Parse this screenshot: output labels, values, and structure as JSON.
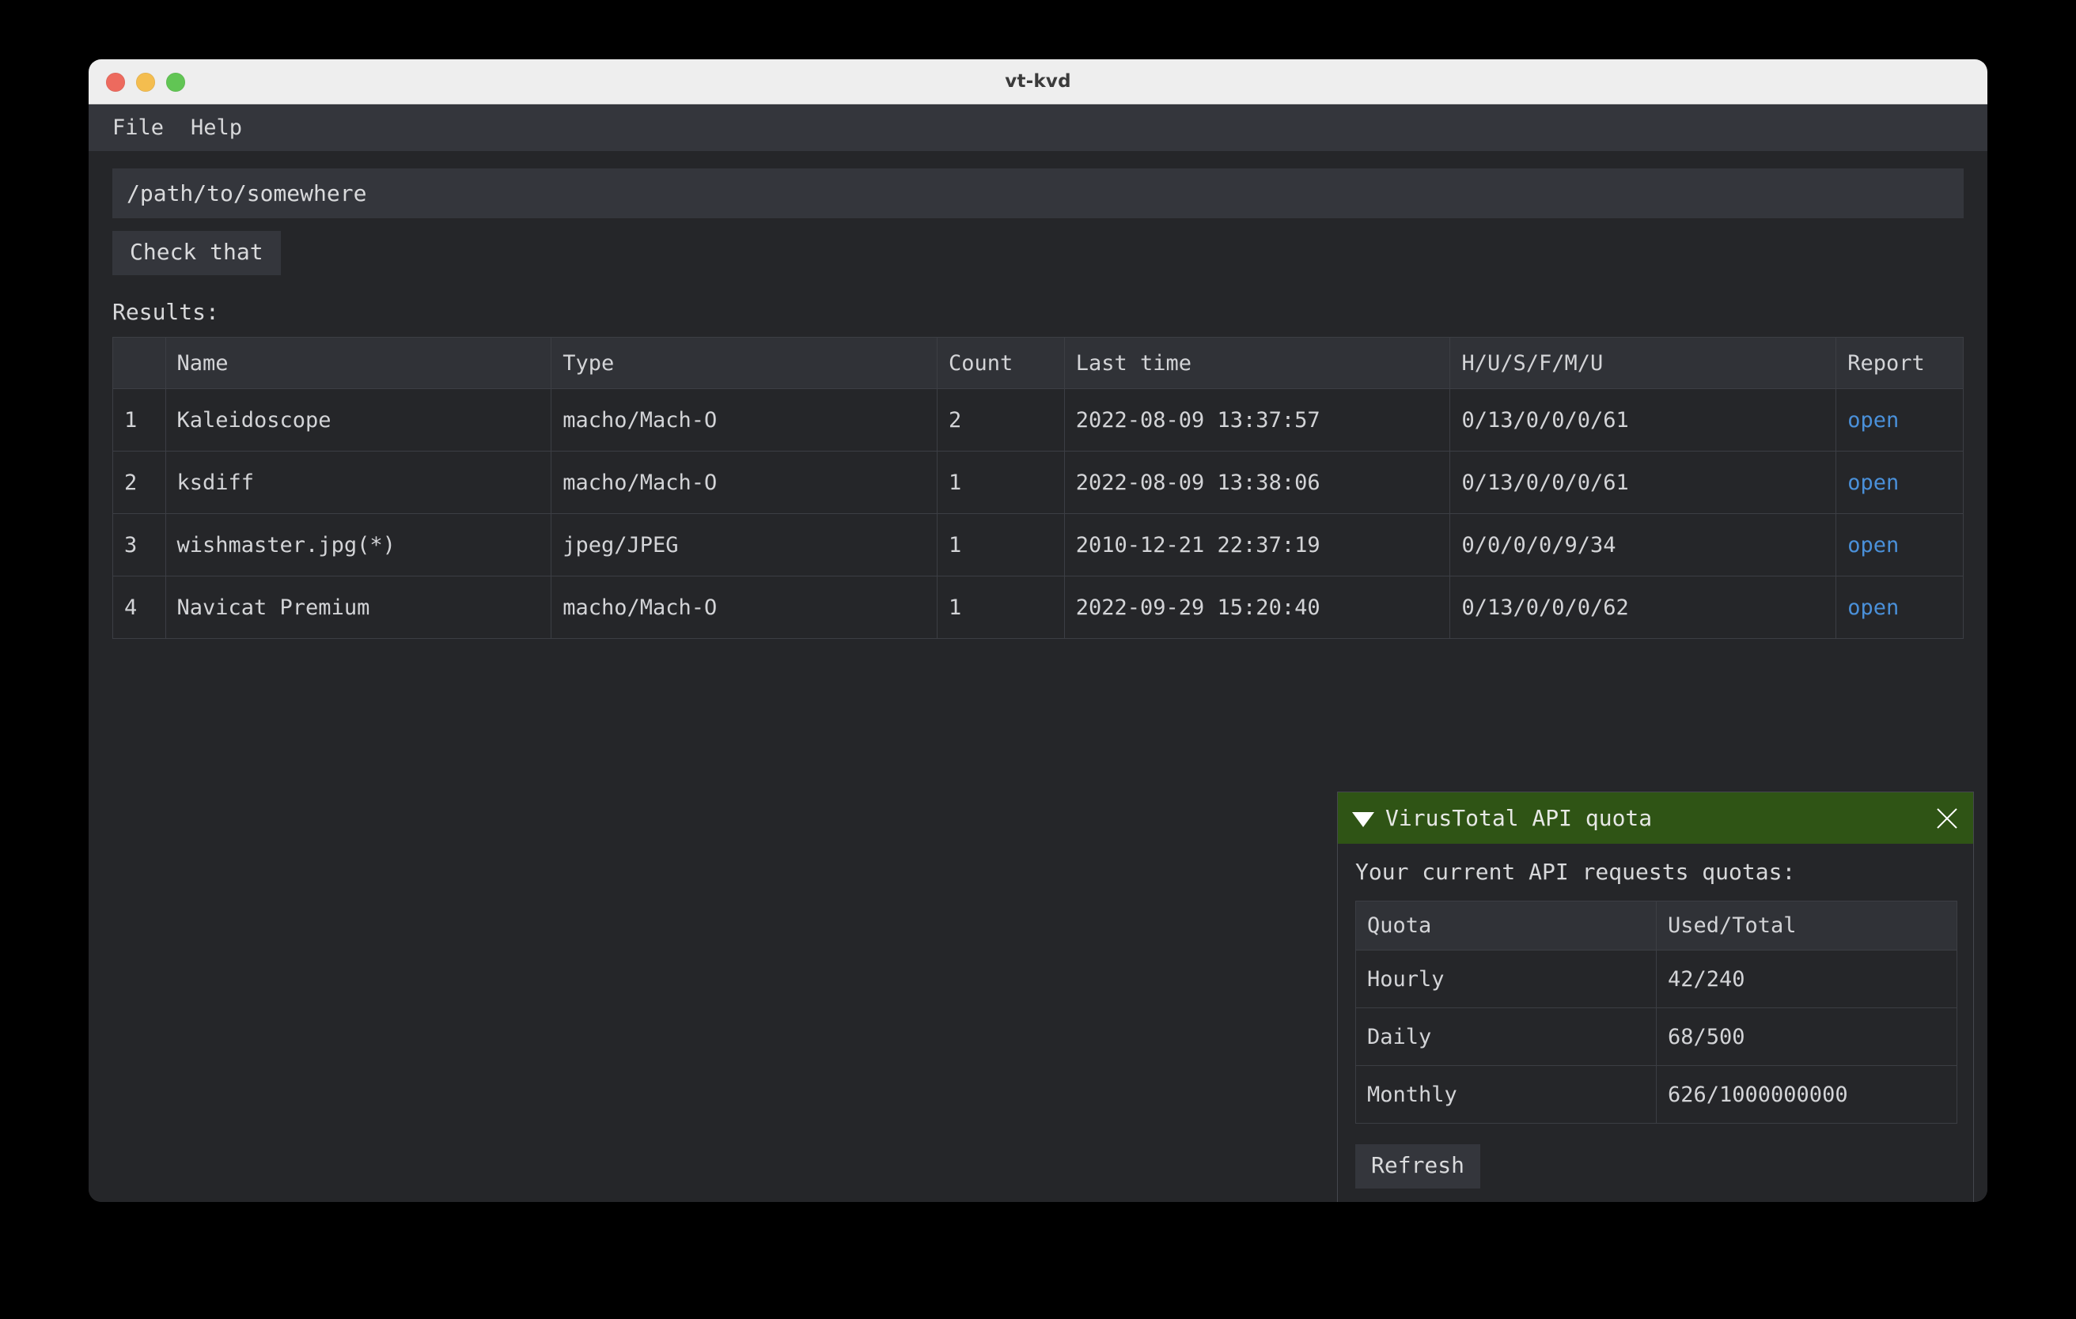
{
  "window": {
    "title": "vt-kvd",
    "traffic_lights": [
      {
        "name": "close",
        "color": "#ed6a5e"
      },
      {
        "name": "minimize",
        "color": "#f4bd4f"
      },
      {
        "name": "zoom",
        "color": "#61c554"
      }
    ]
  },
  "menubar": {
    "items": [
      {
        "label": "File"
      },
      {
        "label": "Help"
      }
    ]
  },
  "toolbar": {
    "path_value": "/path/to/somewhere",
    "path_placeholder": "/path/to/somewhere",
    "check_label": "Check that"
  },
  "results": {
    "label": "Results:",
    "columns": [
      "",
      "Name",
      "Type",
      "Count",
      "Last time",
      "H/U/S/F/M/U",
      "Report"
    ],
    "rows": [
      {
        "index": "1",
        "name": "Kaleidoscope",
        "type": "macho/Mach-O",
        "count": "2",
        "last_time": "2022-08-09 13:37:57",
        "ratio": "0/13/0/0/0/61",
        "ratio_alert": false,
        "report": "open"
      },
      {
        "index": "2",
        "name": "ksdiff",
        "type": "macho/Mach-O",
        "count": "1",
        "last_time": "2022-08-09 13:38:06",
        "ratio": "0/13/0/0/0/61",
        "ratio_alert": false,
        "report": "open"
      },
      {
        "index": "3",
        "name": "wishmaster.jpg(*)",
        "type": "jpeg/JPEG",
        "count": "1",
        "last_time": "2010-12-21 22:37:19",
        "ratio": "0/0/0/0/9/34",
        "ratio_alert": true,
        "report": "open"
      },
      {
        "index": "4",
        "name": "Navicat Premium",
        "type": "macho/Mach-O",
        "count": "1",
        "last_time": "2022-09-29 15:20:40",
        "ratio": "0/13/0/0/0/62",
        "ratio_alert": false,
        "report": "open"
      }
    ]
  },
  "quota_panel": {
    "title": "VirusTotal API quota",
    "collapse_icon": "triangle-down-icon",
    "close_icon": "close-icon",
    "subtitle": "Your current API requests quotas:",
    "columns": [
      "Quota",
      "Used/Total"
    ],
    "rows": [
      {
        "name": "Hourly",
        "value": "42/240"
      },
      {
        "name": "Daily",
        "value": "68/500"
      },
      {
        "name": "Monthly",
        "value": "626/1000000000"
      }
    ],
    "refresh_label": "Refresh"
  },
  "colors": {
    "accent_green": "#2f5415",
    "link_blue": "#4a90d9",
    "alert_red": "#e23b34",
    "window_bg": "#252629",
    "panel_bg": "#34363c"
  }
}
